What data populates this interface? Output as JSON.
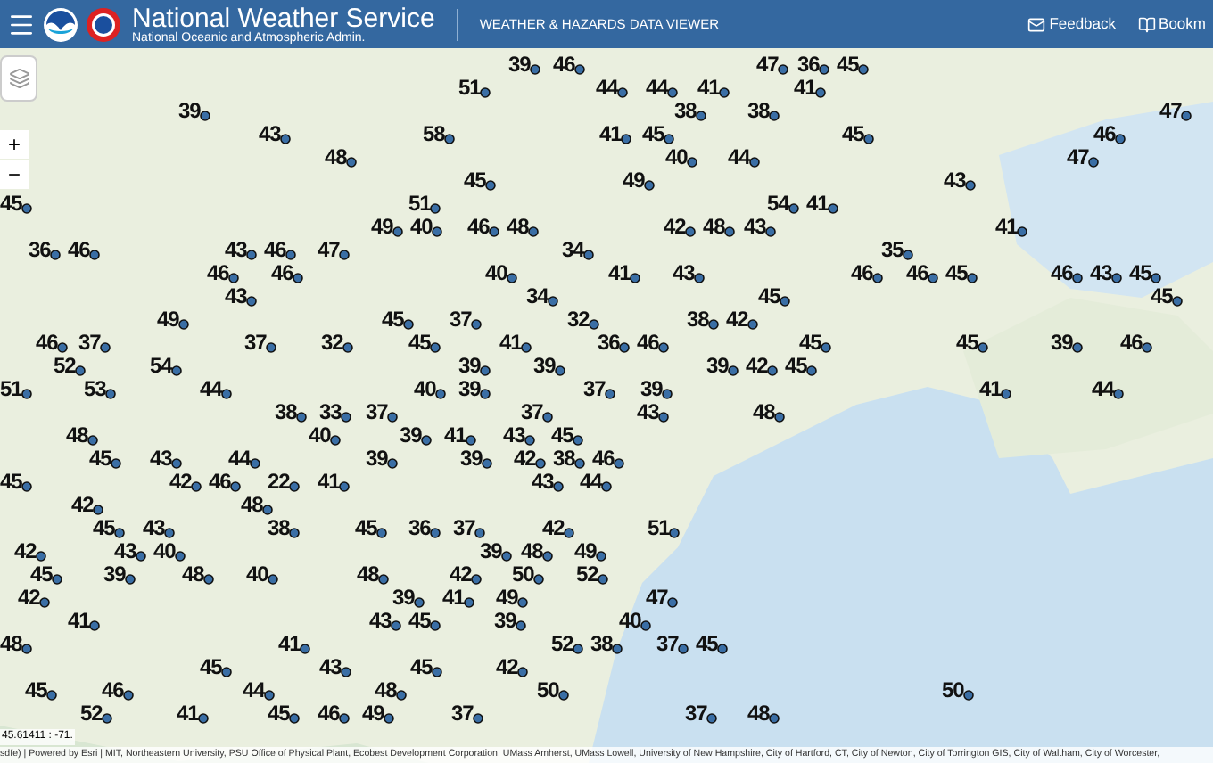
{
  "header": {
    "title": "National Weather Service",
    "subtitle": "National Oceanic and Atmospheric Admin.",
    "app_name": "WEATHER & HAZARDS DATA VIEWER",
    "links": [
      {
        "label": "Feedback",
        "kind": "mail"
      },
      {
        "label": "Bookm",
        "kind": "book"
      }
    ]
  },
  "map": {
    "zoom_in": "+",
    "zoom_out": "−",
    "coordinates": "45.61411 : -71.",
    "attribution": "sdfe) | Powered by Esri | MIT, Northeastern University, PSU Office of Physical Plant, Ecobest Development Corporation, UMass Amherst, UMass Lowell, University of New Hampshire, City of Hartford, CT, City of Newton, City of Torrington GIS, City of Waltham, City of Worcester,",
    "stations": [
      "39",
      "46",
      "47",
      "36",
      "45",
      "51",
      "44",
      "44",
      "41",
      "41",
      "39",
      "38",
      "38",
      "47",
      "43",
      "58",
      "41",
      "45",
      "45",
      "46",
      "48",
      "40",
      "44",
      "47",
      "45",
      "49",
      "43",
      "45",
      "51",
      "54",
      "41",
      "49",
      "40",
      "46",
      "48",
      "42",
      "48",
      "43",
      "41",
      "36",
      "46",
      "43",
      "46",
      "47",
      "34",
      "35",
      "46",
      "46",
      "40",
      "41",
      "43",
      "46",
      "46",
      "45",
      "46",
      "43",
      "45",
      "43",
      "34",
      "45",
      "45",
      "49",
      "45",
      "37",
      "32",
      "38",
      "42",
      "46",
      "37",
      "37",
      "32",
      "45",
      "41",
      "36",
      "46",
      "45",
      "45",
      "39",
      "46",
      "52",
      "54",
      "39",
      "39",
      "39",
      "42",
      "45",
      "51",
      "53",
      "44",
      "40",
      "39",
      "37",
      "39",
      "41",
      "44",
      "38",
      "33",
      "37",
      "37",
      "43",
      "48",
      "48",
      "40",
      "39",
      "41",
      "43",
      "45",
      "45",
      "43",
      "44",
      "39",
      "39",
      "42",
      "38",
      "46",
      "45",
      "42",
      "46",
      "22",
      "41",
      "43",
      "44",
      "42",
      "48",
      "45",
      "43",
      "38",
      "45",
      "36",
      "37",
      "42",
      "51",
      "42",
      "43",
      "40",
      "39",
      "48",
      "49",
      "45",
      "39",
      "48",
      "40",
      "48",
      "42",
      "50",
      "52",
      "42",
      "39",
      "41",
      "49",
      "47",
      "41",
      "43",
      "45",
      "39",
      "40",
      "48",
      "41",
      "52",
      "38",
      "37",
      "45",
      "45",
      "43",
      "45",
      "42",
      "45",
      "46",
      "44",
      "48",
      "50",
      "50",
      "52",
      "41",
      "45",
      "46",
      "49",
      "37",
      "37",
      "48"
    ]
  }
}
